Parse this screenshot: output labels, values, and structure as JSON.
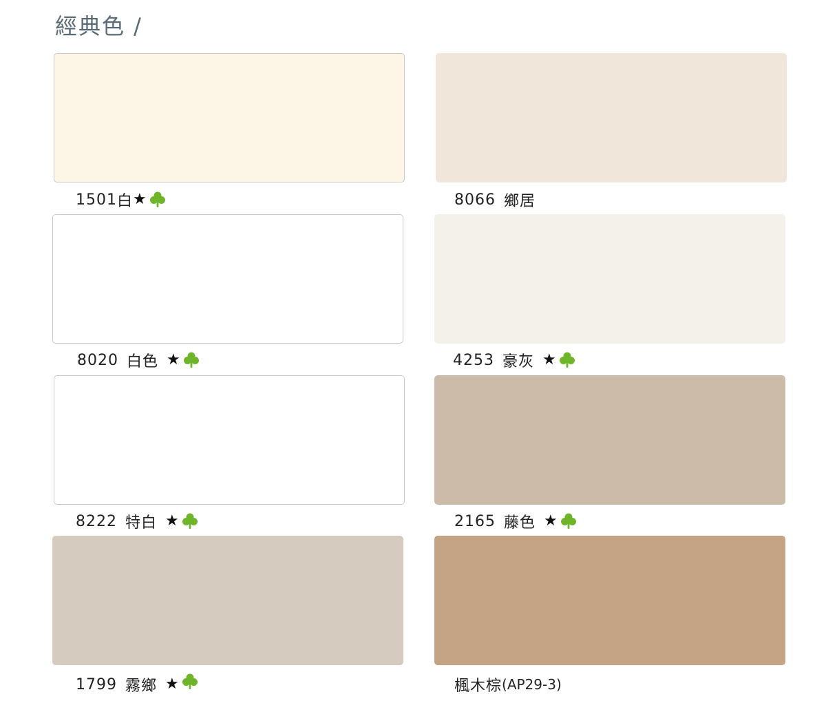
{
  "title": "經典色 /",
  "colors": {
    "star": "#111111",
    "clover": "#6fb52c",
    "title": "#5a6b78"
  },
  "swatches": [
    {
      "code": "1501",
      "name": "白",
      "star": true,
      "clover": true,
      "hex": "#fdf5e6"
    },
    {
      "code": "8066",
      "name": "鄉居",
      "star": false,
      "clover": false,
      "hex": "#f0e7da"
    },
    {
      "code": "8020",
      "name": "白色",
      "star": true,
      "clover": true,
      "hex": "#ffffff"
    },
    {
      "code": "4253",
      "name": "豪灰",
      "star": true,
      "clover": true,
      "hex": "#f4f0ea"
    },
    {
      "code": "8222",
      "name": "特白",
      "star": true,
      "clover": true,
      "hex": "#ffffff"
    },
    {
      "code": "2165",
      "name": "藤色",
      "star": true,
      "clover": true,
      "hex": "#cdbbaa"
    },
    {
      "code": "1799",
      "name": "霧鄉",
      "star": true,
      "clover": true,
      "hex": "#d5cbbe"
    },
    {
      "code": "",
      "name": "楓木棕",
      "suffix": "(AP29-3)",
      "star": false,
      "clover": false,
      "hex": "#c5a385"
    }
  ],
  "icons": {
    "star": "★",
    "clover": "clover-icon"
  }
}
